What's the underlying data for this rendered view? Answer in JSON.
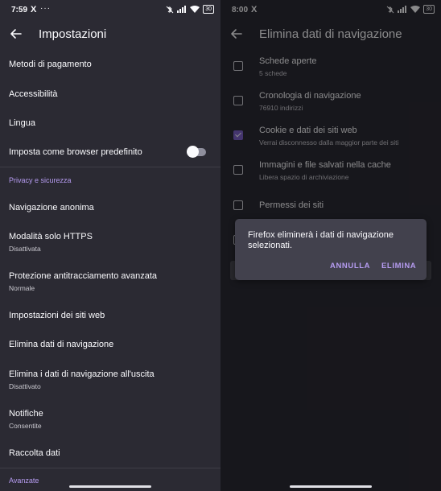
{
  "left": {
    "status": {
      "time": "7:59",
      "x_icon": "X",
      "dots": "···",
      "battery": "30"
    },
    "appbar": {
      "title": "Impostazioni"
    },
    "rows": [
      {
        "label": "Metodi di pagamento"
      },
      {
        "label": "Accessibilità"
      },
      {
        "label": "Lingua"
      },
      {
        "label": "Imposta come browser predefinito",
        "toggle": false
      }
    ],
    "privacy_header": "Privacy e sicurezza",
    "privacy_rows": [
      {
        "label": "Navigazione anonima"
      },
      {
        "label": "Modalità solo HTTPS",
        "sub": "Disattivata"
      },
      {
        "label": "Protezione antitracciamento avanzata",
        "sub": "Normale"
      },
      {
        "label": "Impostazioni dei siti web"
      },
      {
        "label": "Elimina dati di navigazione"
      },
      {
        "label": "Elimina i dati di navigazione all'uscita",
        "sub": "Disattivato"
      },
      {
        "label": "Notifiche",
        "sub": "Consentite"
      },
      {
        "label": "Raccolta dati"
      }
    ],
    "advanced_header": "Avanzate"
  },
  "right": {
    "status": {
      "time": "8:00",
      "x_icon": "X",
      "battery": "30"
    },
    "appbar": {
      "title": "Elimina dati di navigazione"
    },
    "items": [
      {
        "label": "Schede aperte",
        "sub": "5 schede",
        "checked": false
      },
      {
        "label": "Cronologia di navigazione",
        "sub": "76910 indirizzi",
        "checked": false
      },
      {
        "label": "Cookie e dati dei siti web",
        "sub": "Verrai disconnesso dalla maggior parte dei siti",
        "checked": true
      },
      {
        "label": "Immagini e file salvati nella cache",
        "sub": "Libera spazio di archiviazione",
        "checked": false
      },
      {
        "label": "Permessi dei siti",
        "checked": false
      }
    ],
    "dialog": {
      "message": "Firefox eliminerà i dati di navigazione selezionati.",
      "cancel": "ANNULLA",
      "confirm": "ELIMINA"
    }
  },
  "colors": {
    "accent": "#b59bf0",
    "background": "#2b2a33",
    "dialog": "#42414d"
  }
}
